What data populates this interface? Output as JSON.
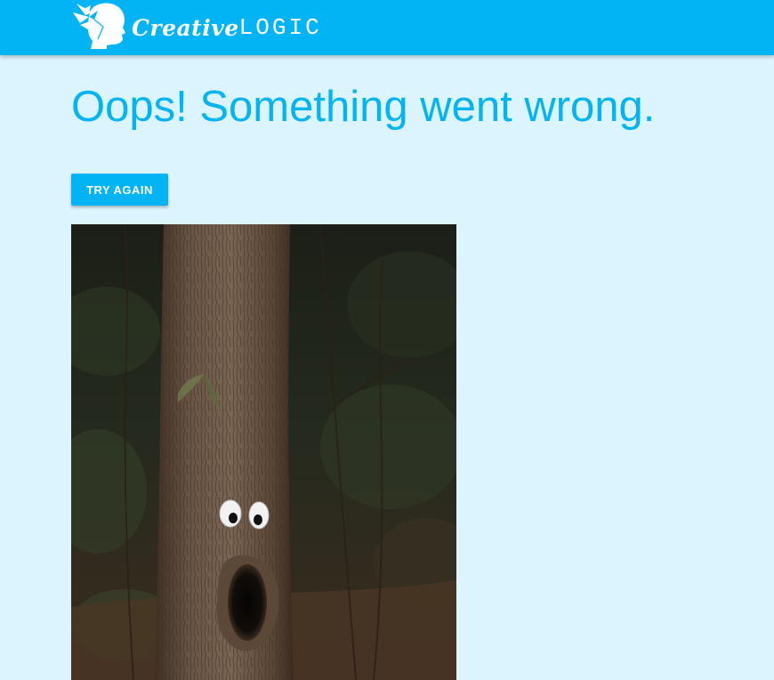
{
  "header": {
    "logo": {
      "icon": "origami-head-icon",
      "brand_part1": "Creative",
      "brand_part2": "LOGIC"
    },
    "background_color": "#03b4f4"
  },
  "main": {
    "title": "Oops! Something went wrong.",
    "retry_label": "TRY AGAIN",
    "image": {
      "subject": "tree-trunk-with-googly-eyes-image"
    },
    "background_color": "#dcf4fd",
    "accent_color": "#03b4f4"
  }
}
